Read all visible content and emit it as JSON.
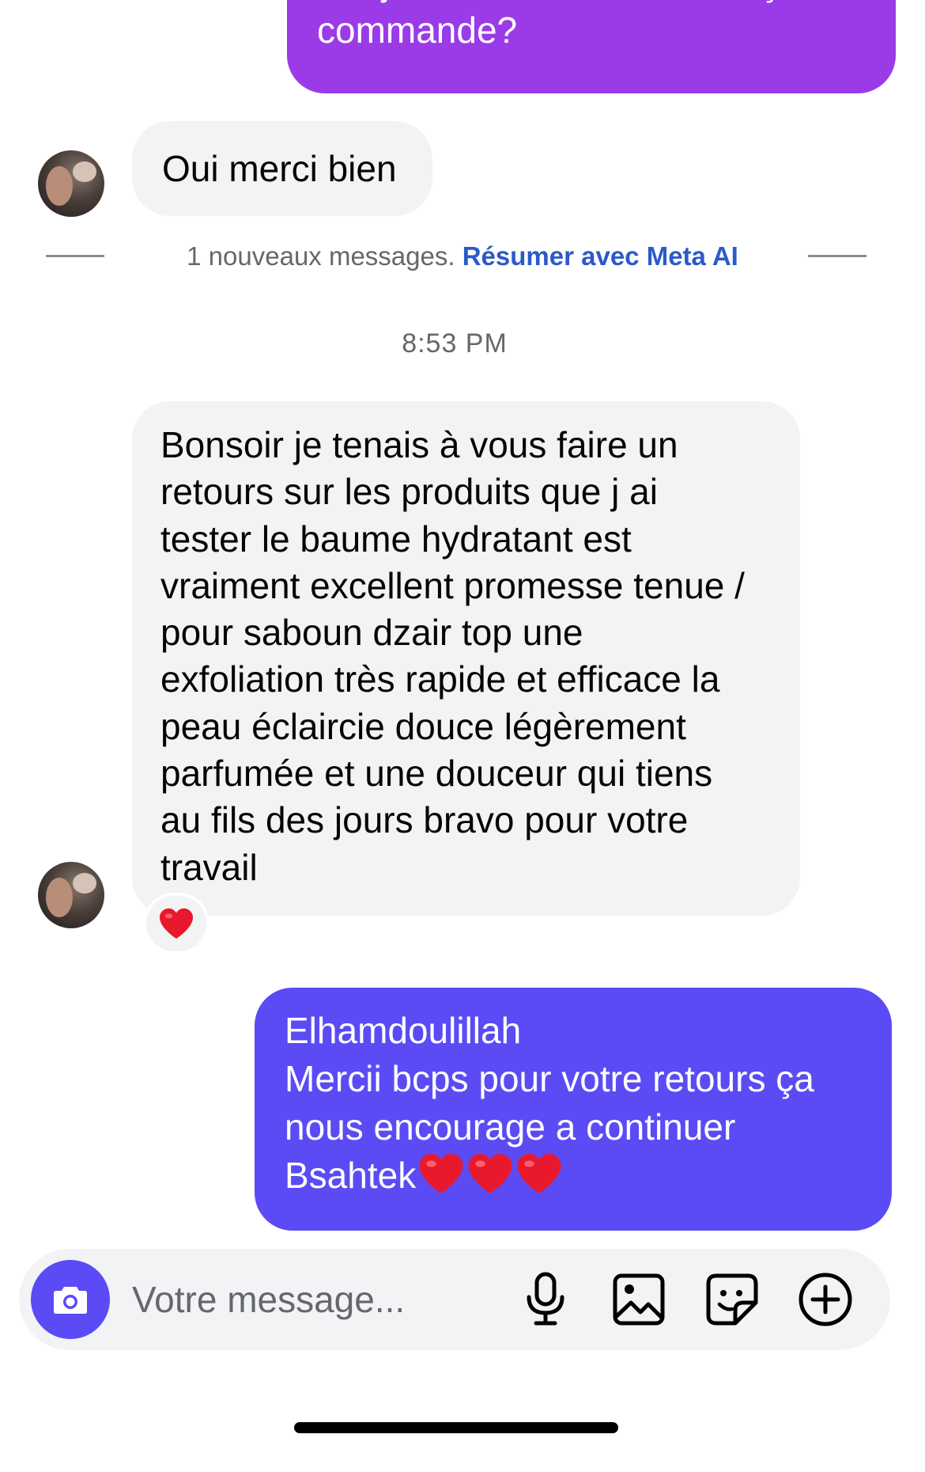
{
  "messages": {
    "prev_outgoing": {
      "line1": "Bonjour , avez-vous bien reçu la",
      "line2": "commande?"
    },
    "reply_short": "Oui merci bien",
    "divider": {
      "text": "1 nouveaux messages.",
      "link": "Résumer avec Meta AI"
    },
    "timestamp": "8:53 PM",
    "review_lines": [
      "Bonsoir je tenais à vous faire un",
      "retours sur les produits que j ai",
      "tester le baume hydratant est",
      "vraiment excellent promesse tenue /",
      "pour saboun dzair top une",
      "exfoliation très rapide et efficace la",
      "peau éclaircie douce légèrement",
      "parfumée et une douceur qui tiens",
      "au fils des jours bravo pour votre",
      "travail"
    ],
    "review_reaction": "heart-emoji",
    "reply_out": {
      "line1": "Elhamdoulillah",
      "line2": "Mercii bcps pour votre retours  ça",
      "line3": "nous encourage a continuer",
      "line4": "Bsahtek"
    }
  },
  "composer": {
    "placeholder": "Votre message...",
    "icons": [
      "camera-icon",
      "microphone-icon",
      "gallery-icon",
      "sticker-icon",
      "plus-circle-icon"
    ]
  },
  "colors": {
    "outgoing_top": "#9b3be8",
    "outgoing_bottom": "#5b4bf5",
    "incoming": "#f2f3f5",
    "link": "#2b5ac9",
    "muted": "#65676b"
  }
}
